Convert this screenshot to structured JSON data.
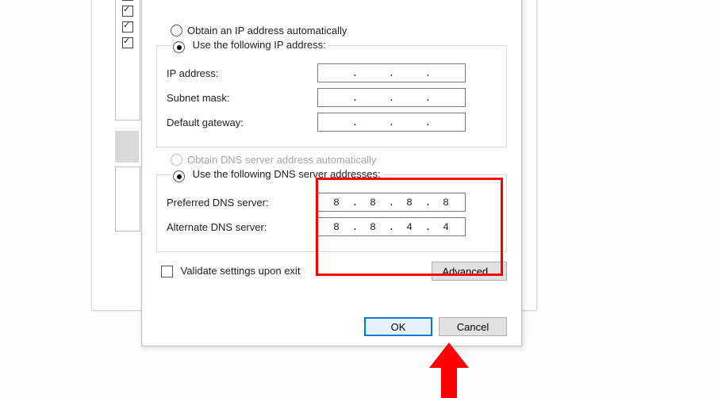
{
  "ip_section": {
    "obtain_auto_label": "Obtain an IP address automatically",
    "use_following_label": "Use the following IP address:",
    "ip_address_label": "IP address:",
    "subnet_label": "Subnet mask:",
    "gateway_label": "Default gateway:",
    "ip_address_value": [
      "",
      "",
      "",
      ""
    ],
    "subnet_value": [
      "",
      "",
      "",
      ""
    ],
    "gateway_value": [
      "",
      "",
      "",
      ""
    ]
  },
  "dns_section": {
    "obtain_auto_label": "Obtain DNS server address automatically",
    "use_following_label": "Use the following DNS server addresses:",
    "preferred_label": "Preferred DNS server:",
    "alternate_label": "Alternate DNS server:",
    "preferred_value": [
      "8",
      "8",
      "8",
      "8"
    ],
    "alternate_value": [
      "8",
      "8",
      "4",
      "4"
    ]
  },
  "validate_label": "Validate settings upon exit",
  "buttons": {
    "advanced": "Advanced...",
    "ok": "OK",
    "cancel": "Cancel"
  },
  "highlight_color": "#ff0000"
}
